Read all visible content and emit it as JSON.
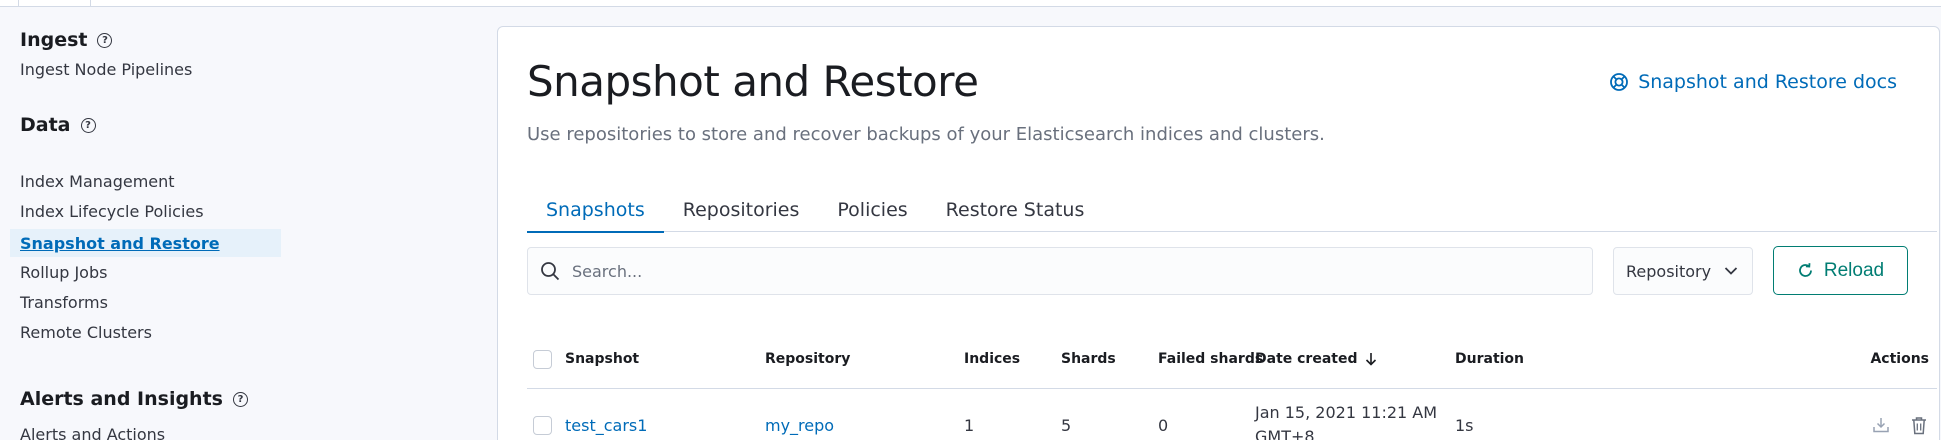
{
  "sidebar": {
    "groups": [
      {
        "title": "Ingest",
        "items": [
          "Ingest Node Pipelines"
        ]
      },
      {
        "title": "Data",
        "items": [
          "Index Management",
          "Index Lifecycle Policies",
          "Snapshot and Restore",
          "Rollup Jobs",
          "Transforms",
          "Remote Clusters"
        ]
      },
      {
        "title": "Alerts and Insights",
        "items": [
          "Alerts and Actions"
        ]
      }
    ],
    "active_item": "Snapshot and Restore"
  },
  "page": {
    "title": "Snapshot and Restore",
    "subtitle": "Use repositories to store and recover backups of your Elasticsearch indices and clusters.",
    "docs_link": "Snapshot and Restore docs"
  },
  "tabs": [
    "Snapshots",
    "Repositories",
    "Policies",
    "Restore Status"
  ],
  "active_tab": "Snapshots",
  "toolbar": {
    "search_placeholder": "Search...",
    "repository_filter": "Repository",
    "reload_label": "Reload"
  },
  "table": {
    "columns": [
      "Snapshot",
      "Repository",
      "Indices",
      "Shards",
      "Failed shards",
      "Date created",
      "Duration",
      "Actions"
    ],
    "sorted_column": "Date created",
    "sort_direction": "descending",
    "rows": [
      {
        "snapshot": "test_cars1",
        "repository": "my_repo",
        "indices": "1",
        "shards": "5",
        "failed_shards": "0",
        "date_line1": "Jan 15, 2021 11:21 AM",
        "date_line2": "GMT+8",
        "duration": "1s"
      }
    ]
  },
  "colors": {
    "link": "#006bb8",
    "accent_green": "#017d73",
    "active_nav_bg": "#e6f1fa",
    "text": "#343741",
    "border": "#d3dae6"
  },
  "icons": {
    "help": "question-circle-icon",
    "docs": "help-lifebuoy-icon",
    "search": "magnifier-icon",
    "dropdown": "chevron-down-icon",
    "reload": "refresh-icon",
    "sort": "arrow-down-icon",
    "restore": "download-icon",
    "delete": "trash-icon"
  }
}
